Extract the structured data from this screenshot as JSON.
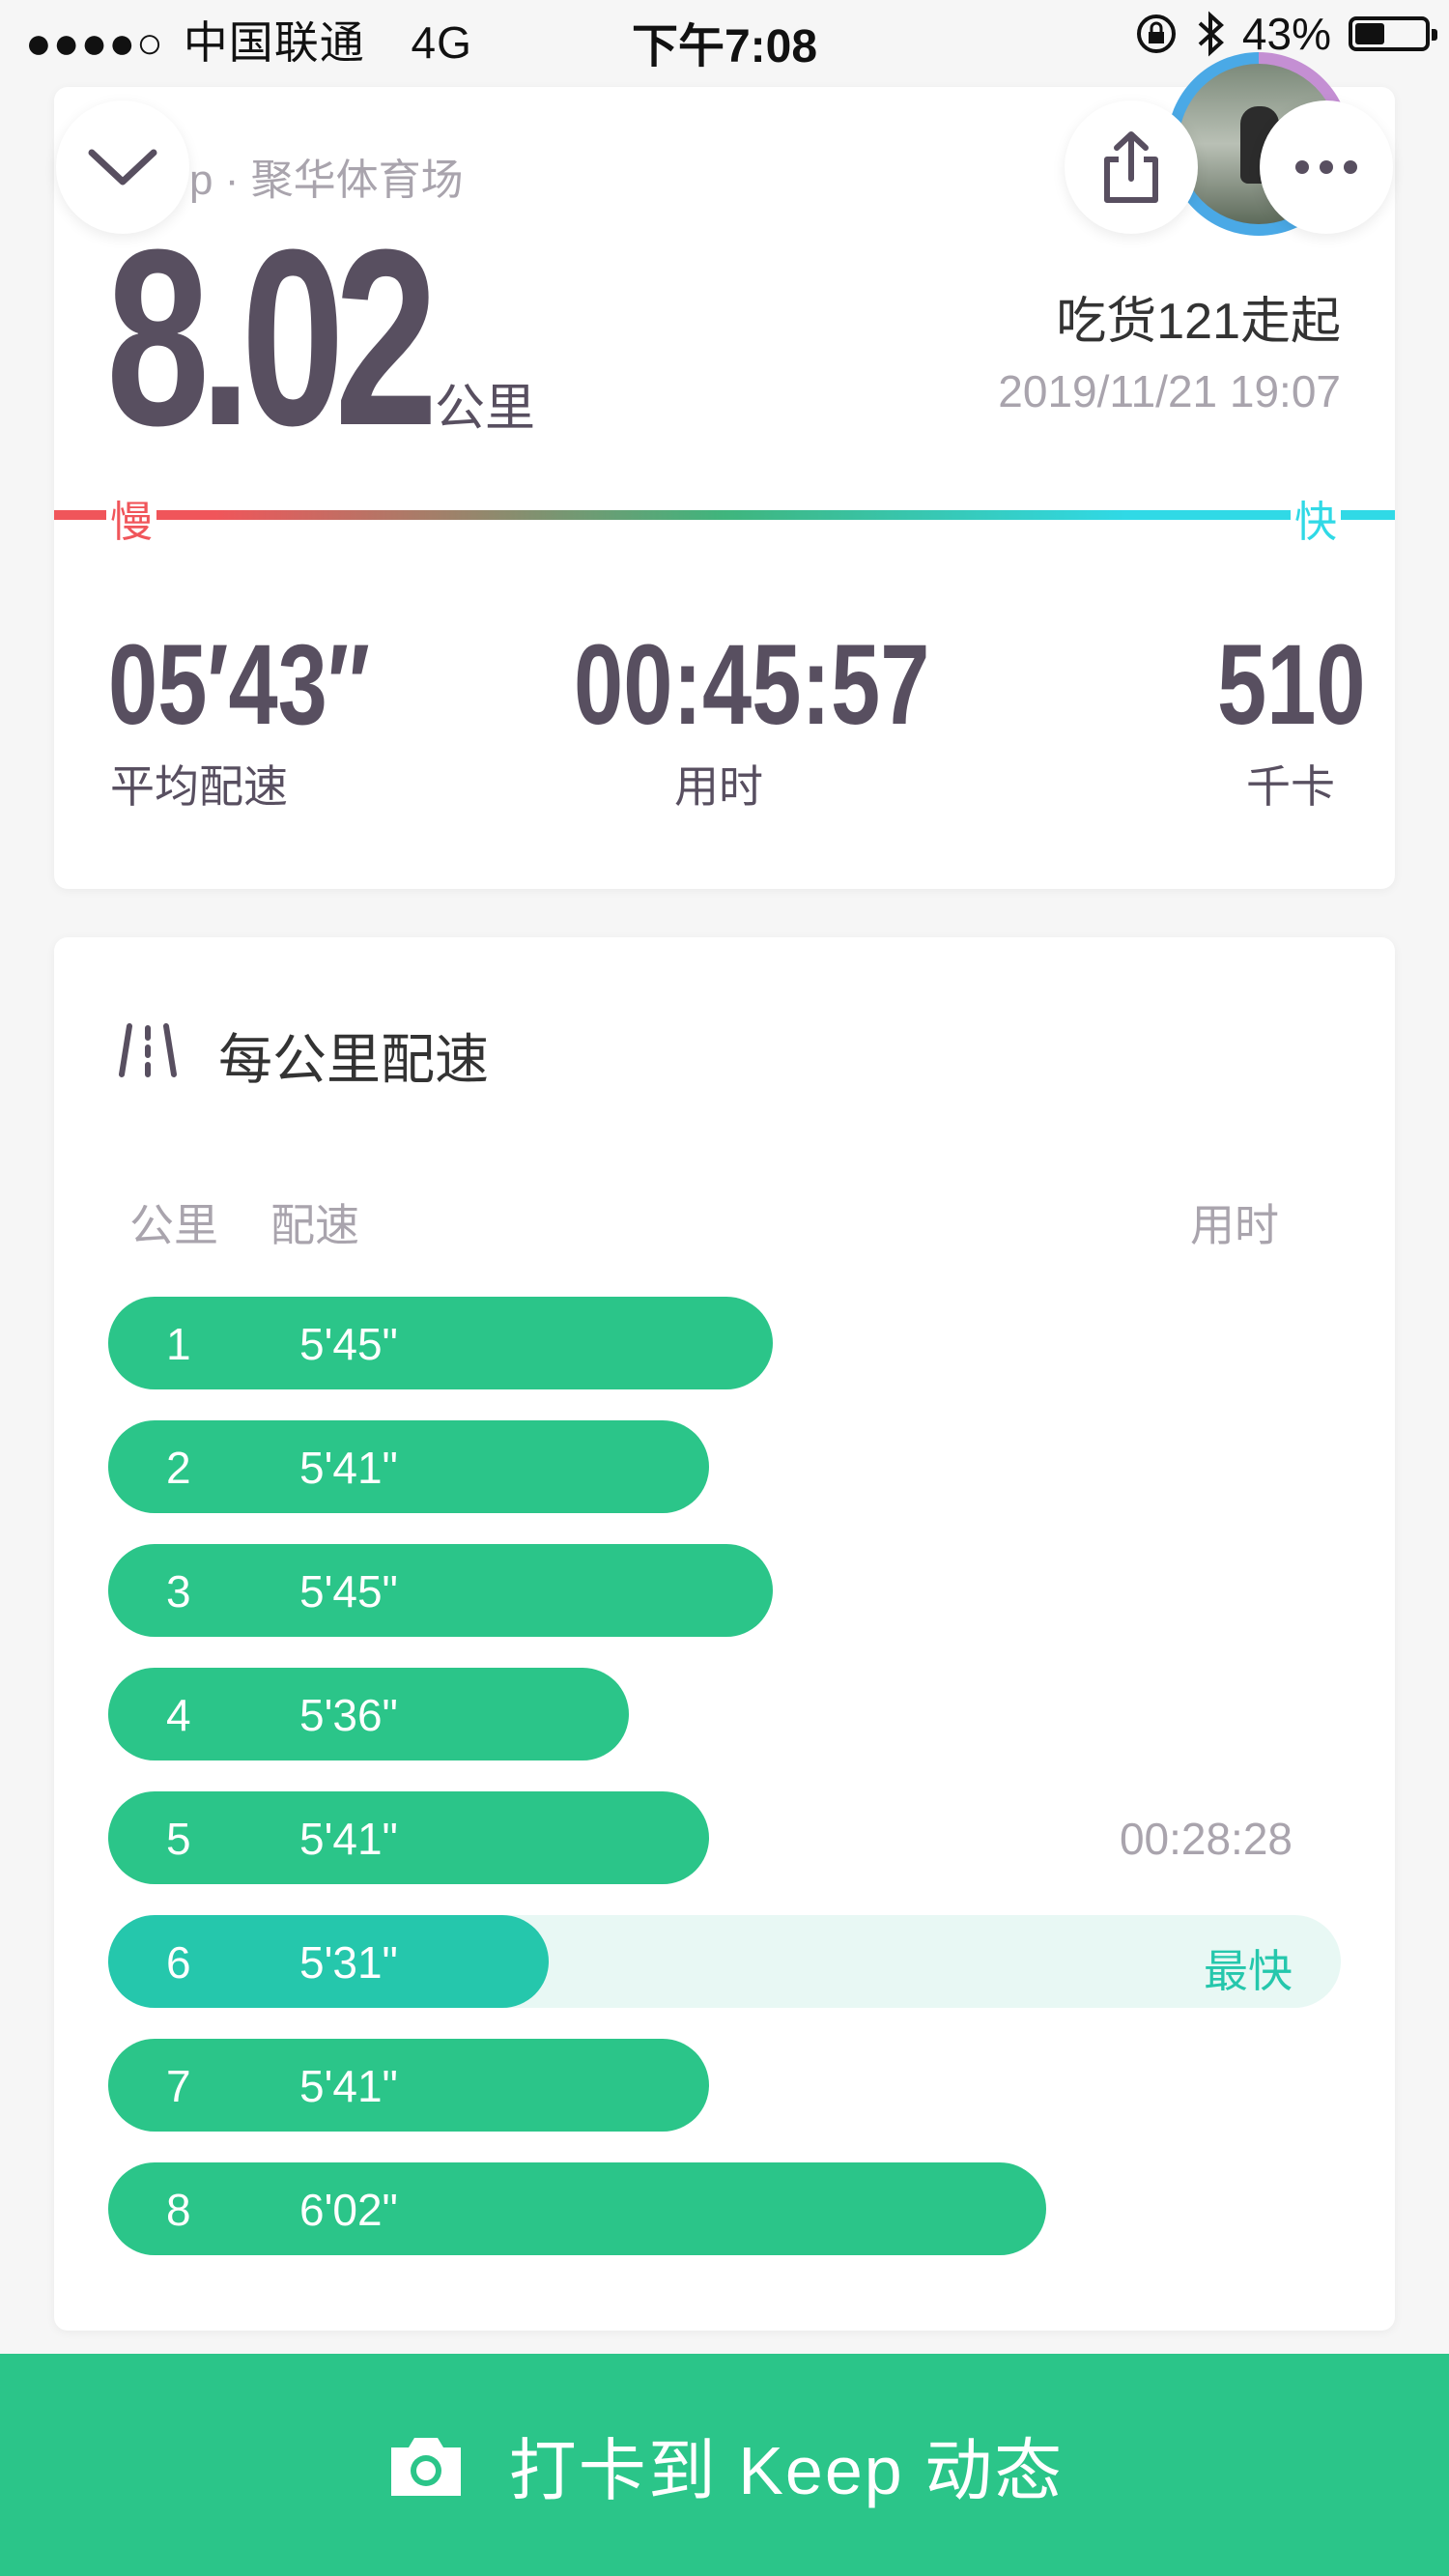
{
  "status_bar": {
    "signal": "●●●●○",
    "carrier": "中国联通",
    "network": "4G",
    "time": "下午7:08",
    "battery": "43%",
    "battery_level": 0.43
  },
  "summary": {
    "location": "p · 聚华体育场",
    "distance": "8.02",
    "distance_unit": "公里",
    "username": "吃货121走起",
    "datetime": "2019/11/21 19:07",
    "speed_slow": "慢",
    "speed_fast": "快",
    "stats": [
      {
        "value": "05′43″",
        "label": "平均配速"
      },
      {
        "value": "00:45:57",
        "label": "用时"
      },
      {
        "value": "510",
        "label": "千卡"
      }
    ]
  },
  "pace": {
    "title": "每公里配速",
    "header_km": "公里",
    "header_pace": "配速",
    "header_time": "用时",
    "rows": [
      {
        "km": "1",
        "pace": "5'45\"",
        "pace_seconds": 345,
        "right": ""
      },
      {
        "km": "2",
        "pace": "5'41\"",
        "pace_seconds": 341,
        "right": ""
      },
      {
        "km": "3",
        "pace": "5'45\"",
        "pace_seconds": 345,
        "right": ""
      },
      {
        "km": "4",
        "pace": "5'36\"",
        "pace_seconds": 336,
        "right": ""
      },
      {
        "km": "5",
        "pace": "5'41\"",
        "pace_seconds": 341,
        "right": "00:28:28"
      },
      {
        "km": "6",
        "pace": "5'31\"",
        "pace_seconds": 331,
        "right": "最快",
        "fastest": true
      },
      {
        "km": "7",
        "pace": "5'41\"",
        "pace_seconds": 341,
        "right": ""
      },
      {
        "km": "8",
        "pace": "6'02\"",
        "pace_seconds": 362,
        "right": ""
      }
    ]
  },
  "bottom_button": {
    "label": "打卡到 Keep 动态"
  },
  "colors": {
    "accent_green": "#2bc589",
    "fastest_teal": "#25c7ac",
    "slow_red": "#f0555a",
    "fast_cyan": "#30d9e6"
  }
}
